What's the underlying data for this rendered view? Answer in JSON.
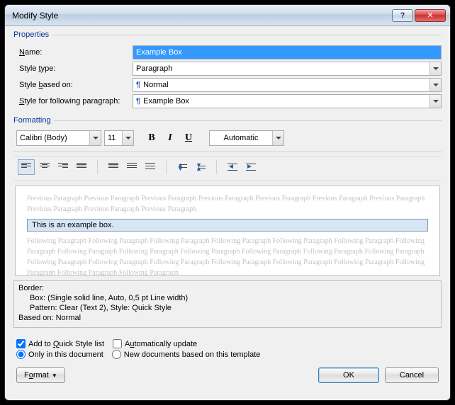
{
  "titlebar": {
    "title": "Modify Style"
  },
  "properties": {
    "legend": "Properties",
    "name_label": "Name:",
    "name_value": "Example Box",
    "type_label": "Style type:",
    "type_value": "Paragraph",
    "based_label": "Style based on:",
    "based_value": "Normal",
    "following_label": "Style for following paragraph:",
    "following_value": "Example Box"
  },
  "formatting": {
    "legend": "Formatting",
    "font": "Calibri (Body)",
    "size": "11",
    "color": "Automatic"
  },
  "preview": {
    "prev_text": "Previous Paragraph Previous Paragraph Previous Paragraph Previous Paragraph Previous Paragraph Previous Paragraph Previous Paragraph Previous Paragraph Previous Paragraph Previous Paragraph",
    "example": "This is an example box.",
    "next_text": "Following Paragraph Following Paragraph Following Paragraph Following Paragraph Following Paragraph Following Paragraph Following Paragraph Following Paragraph Following Paragraph Following Paragraph Following Paragraph Following Paragraph Following Paragraph Following Paragraph Following Paragraph Following Paragraph Following Paragraph Following Paragraph Following Paragraph Following Paragraph Following Paragraph Following Paragraph"
  },
  "info": {
    "line1": "Border:",
    "line2": "Box: (Single solid line, Auto,  0,5 pt Line width)",
    "line3": "Pattern: Clear (Text 2), Style: Quick Style",
    "line4": "Based on: Normal"
  },
  "options": {
    "add_quick": "Add to Quick Style list",
    "auto_update": "Automatically update",
    "only_doc": "Only in this document",
    "new_docs": "New documents based on this template"
  },
  "buttons": {
    "format": "Format",
    "ok": "OK",
    "cancel": "Cancel"
  }
}
